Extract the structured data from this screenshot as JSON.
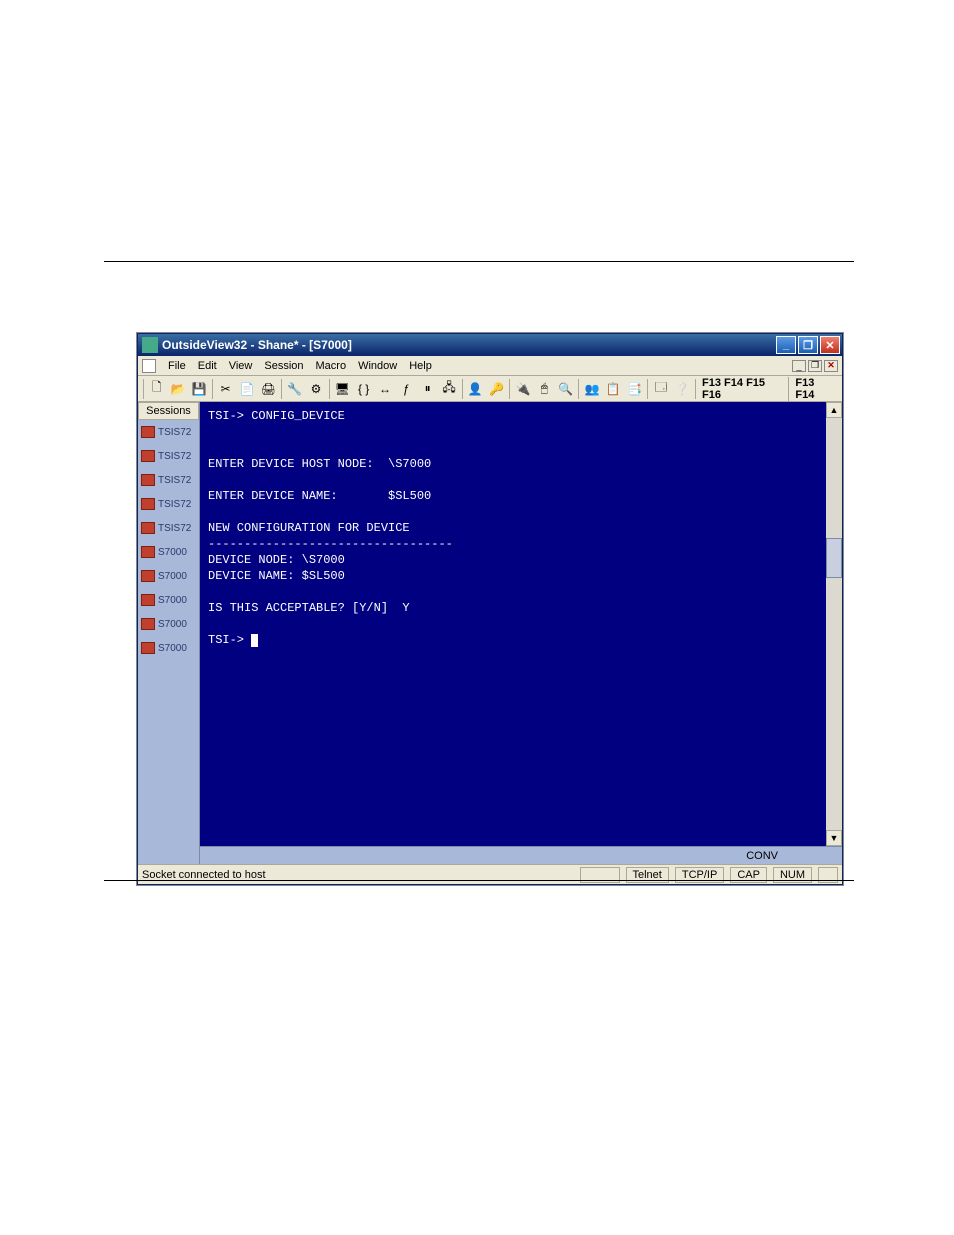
{
  "window": {
    "title": "OutsideView32 - Shane* - [S7000]",
    "buttons": {
      "min": "_",
      "max": "❐",
      "close": "✕"
    }
  },
  "mdi": {
    "min": "_",
    "restore": "❐",
    "close": "✕"
  },
  "menubar": {
    "items": [
      "File",
      "Edit",
      "View",
      "Session",
      "Macro",
      "Window",
      "Help"
    ]
  },
  "toolbar": {
    "icons": [
      "🗋",
      "📂",
      "💾",
      "✂",
      "📄",
      "🖨",
      "🔧",
      "⚙",
      "🖥",
      "{ }",
      "↔",
      "ƒ",
      "⏸",
      "🖧",
      "👤",
      "🔑",
      "🔌",
      "🖱",
      "🔍",
      "👥",
      "📋",
      "📑",
      "🗔",
      "❔"
    ],
    "fkeys_left": "F13 F14 F15 F16",
    "fkeys_right": "F13 F14"
  },
  "sessions": {
    "header": "Sessions",
    "items": [
      "TSIS72",
      "TSIS72",
      "TSIS72",
      "TSIS72",
      "TSIS72",
      "S7000",
      "S7000",
      "S7000",
      "S7000",
      "S7000"
    ]
  },
  "terminal": {
    "lines": [
      "TSI-> CONFIG_DEVICE",
      "",
      "",
      "ENTER DEVICE HOST NODE:  \\S7000",
      "",
      "ENTER DEVICE NAME:       $SL500",
      "",
      "NEW CONFIGURATION FOR DEVICE",
      "----------------------------------",
      "DEVICE NODE: \\S7000",
      "DEVICE NAME: $SL500",
      "",
      "IS THIS ACCEPTABLE? [Y/N]  Y",
      "",
      "TSI->"
    ],
    "status_right": "CONV"
  },
  "statusbar": {
    "message": "Socket connected to host",
    "cells": [
      "",
      "Telnet",
      "TCP/IP",
      "CAP",
      "NUM",
      ""
    ]
  }
}
